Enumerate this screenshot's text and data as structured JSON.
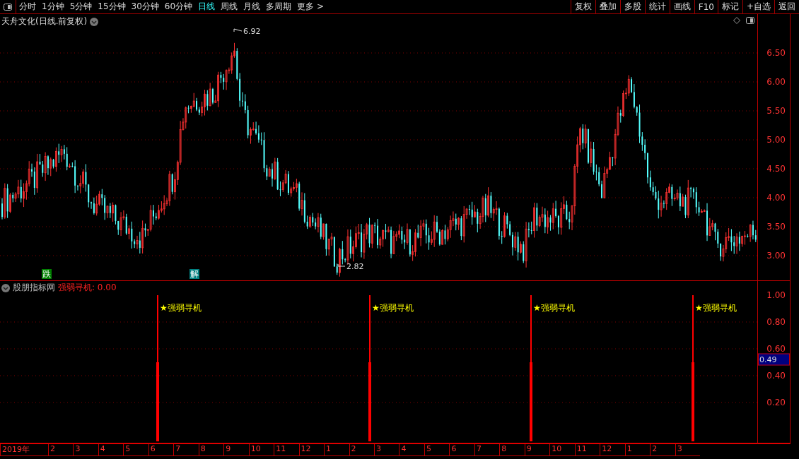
{
  "toolbar": {
    "periods": [
      {
        "label": "分时",
        "selected": false
      },
      {
        "label": "1分钟",
        "selected": false
      },
      {
        "label": "5分钟",
        "selected": false
      },
      {
        "label": "15分钟",
        "selected": false
      },
      {
        "label": "30分钟",
        "selected": false
      },
      {
        "label": "60分钟",
        "selected": false
      },
      {
        "label": "日线",
        "selected": true
      },
      {
        "label": "周线",
        "selected": false
      },
      {
        "label": "月线",
        "selected": false
      },
      {
        "label": "多周期",
        "selected": false
      },
      {
        "label": "更多 >",
        "selected": false
      }
    ],
    "buttons": [
      "复权",
      "叠加",
      "多股",
      "统计",
      "画线",
      "F10",
      "标记",
      "+自选",
      "返回"
    ]
  },
  "price_chart": {
    "title": "天舟文化(日线.前复权)",
    "high_label": "6.92",
    "low_label": "2.82",
    "markers": [
      {
        "label": "跌",
        "color": "#008000"
      },
      {
        "label": "解",
        "color": "#008080"
      }
    ],
    "y_axis": [
      "6.50",
      "6.00",
      "5.50",
      "5.00",
      "4.50",
      "4.00",
      "3.50",
      "3.00"
    ]
  },
  "indicator": {
    "source": "股朋指标网",
    "reading": "强弱寻机: 0.00",
    "signals": [
      "★强弱寻机",
      "★强弱寻机",
      "★强弱寻机",
      "★强弱寻机"
    ],
    "y_axis": [
      "1.00",
      "0.80",
      "0.60",
      "0.40",
      "0.20"
    ],
    "cursor_value": "0.49"
  },
  "date_axis": [
    "2019年",
    "2",
    "3",
    "4",
    "5",
    "6",
    "7",
    "8",
    "9",
    "10",
    "11",
    "12",
    "1",
    "2",
    "3",
    "4",
    "5",
    "6",
    "7",
    "8",
    "9",
    "10",
    "11",
    "12",
    "1",
    "2",
    "3"
  ]
}
